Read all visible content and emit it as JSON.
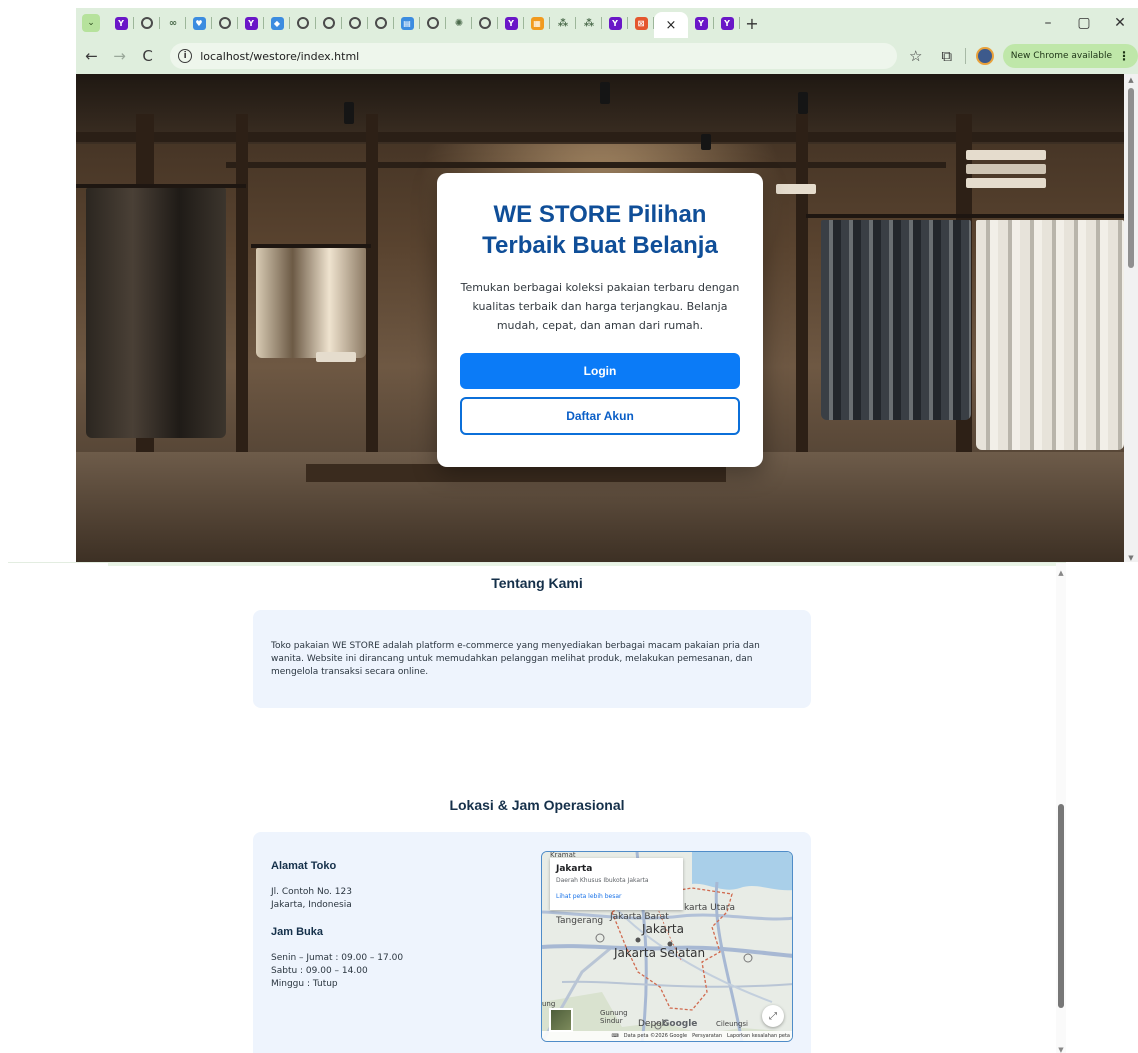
{
  "browser": {
    "tabs_collapsed_icon": "chevron-down-icon",
    "active_tab_close": "×",
    "new_tab": "+",
    "window_controls": {
      "minimize": "–",
      "restore": "▢",
      "close": "✕"
    },
    "url": "localhost/westore/index.html",
    "update_label": "New Chrome available",
    "update_menu": "⋮",
    "nav": {
      "back": "←",
      "forward": "→",
      "reload": "C"
    },
    "toolbar_icons": {
      "bookmark": "☆",
      "extensions": "⧉"
    }
  },
  "hero": {
    "title": "WE STORE Pilihan Terbaik Buat Belanja",
    "description": "Temukan berbagai koleksi pakaian terbaru dengan kualitas terbaik dan harga terjangkau. Belanja mudah, cepat, dan aman dari rumah.",
    "login_label": "Login",
    "register_label": "Daftar Akun"
  },
  "about": {
    "title": "Tentang Kami",
    "text": "Toko pakaian WE STORE adalah platform e-commerce yang menyediakan berbagai macam pakaian pria dan wanita. Website ini dirancang untuk memudahkan pelanggan melihat produk, melakukan pemesanan, dan mengelola transaksi secara online."
  },
  "location": {
    "title": "Lokasi & Jam Operasional",
    "address_heading": "Alamat Toko",
    "address_lines": [
      "Jl. Contoh No. 123",
      "Jakarta, Indonesia"
    ],
    "hours_heading": "Jam Buka",
    "hours_lines": [
      "Senin – Jumat : 09.00 – 17.00",
      "Sabtu : 09.00 – 14.00",
      "Minggu : Tutup"
    ]
  },
  "map": {
    "info_title": "Jakarta",
    "info_subtitle": "Daerah Khusus Ibukota Jakarta",
    "info_link": "Lihat peta lebih besar",
    "labels": {
      "top": "Kramat",
      "north": "karta Utara",
      "tangerang": "Tangerang",
      "west": "Jakarta Barat",
      "center": "Jakarta",
      "south": "Jakarta Selatan",
      "gunung": "Gunung",
      "sindur": "Sindur",
      "depok": "Depok",
      "cileungsi": "Cileungsi",
      "left_edge": "ung"
    },
    "google": "Google",
    "footer": [
      "Data peta ©2026 Google",
      "Persyaratan",
      "Laporkan kesalahan peta"
    ]
  },
  "colors": {
    "brand_blue": "#0f4e98",
    "button_blue": "#0b7bf7",
    "panel_bg": "#eef4fd",
    "browser_frame": "#dfeedd"
  }
}
